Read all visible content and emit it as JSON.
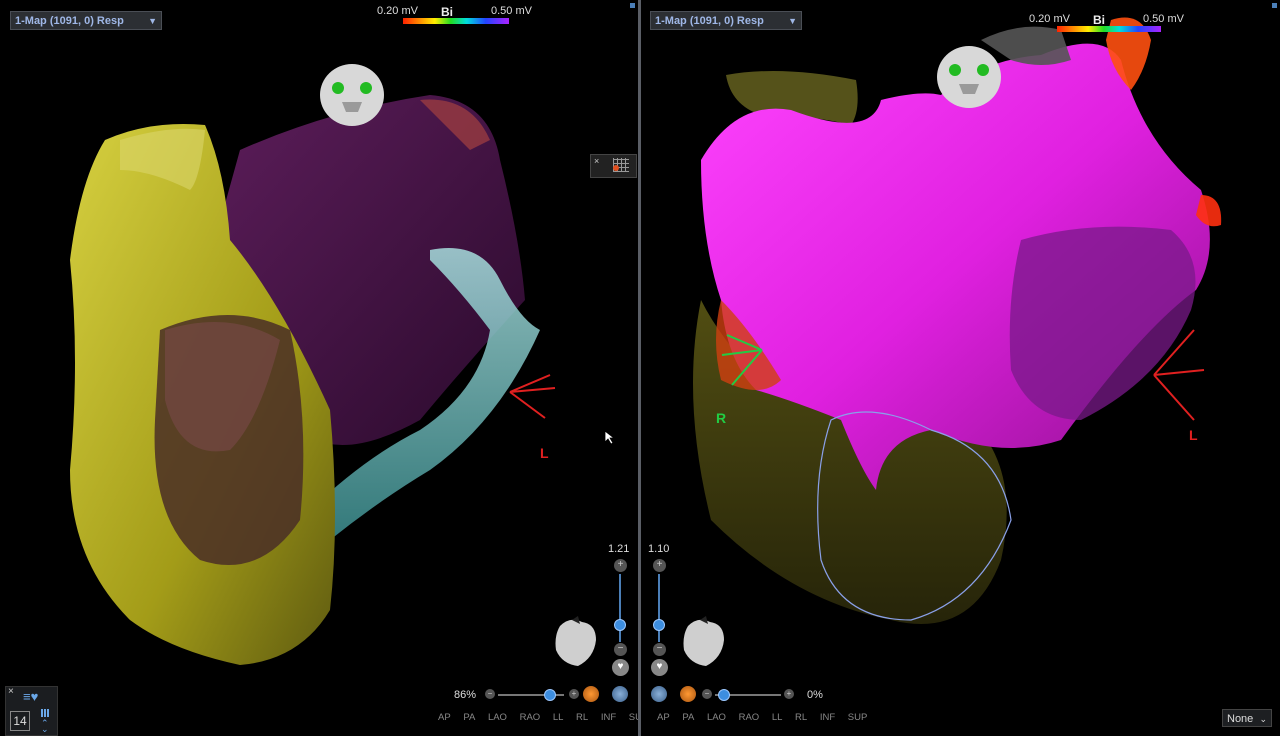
{
  "left_view": {
    "map_selector": "1-Map (1091, 0) Resp",
    "scale_min": "0.20 mV",
    "scale_type": "Bi",
    "scale_max": "0.50 mV",
    "orientation_L": "L",
    "zoom_value": "1.21",
    "zoom_percent": "86%",
    "view_buttons": [
      "AP",
      "PA",
      "LAO",
      "RAO",
      "LL",
      "RL",
      "INF",
      "SUP"
    ]
  },
  "right_view": {
    "map_selector": "1-Map (1091, 0) Resp",
    "scale_min": "0.20 mV",
    "scale_type": "Bi",
    "scale_max": "0.50 mV",
    "orientation_R": "R",
    "orientation_L": "L",
    "zoom_value": "1.10",
    "zoom_percent": "0%",
    "view_buttons": [
      "AP",
      "PA",
      "LAO",
      "RAO",
      "LL",
      "RL",
      "INF",
      "SUP"
    ]
  },
  "bottom_panel": {
    "count": "14",
    "close": "×"
  },
  "display_select": "None",
  "colors": {
    "orientation_red": "#e02020",
    "orientation_green": "#22cc44",
    "magenta": "#ee22ee",
    "yellow": "#b6b020"
  }
}
